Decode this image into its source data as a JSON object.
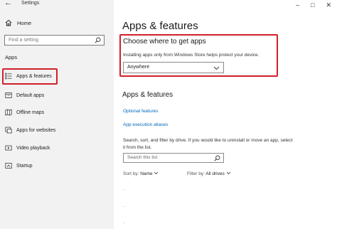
{
  "window": {
    "title": "Settings",
    "back_glyph": "←",
    "close_glyph": "✕",
    "minimize_glyph": "–",
    "maximize_glyph": "□"
  },
  "sidebar": {
    "home_label": "Home",
    "search_placeholder": "Find a setting",
    "section_label": "Apps",
    "items": [
      {
        "label": "Apps & features",
        "icon": "list-icon"
      },
      {
        "label": "Default apps",
        "icon": "default-apps-icon"
      },
      {
        "label": "Offline maps",
        "icon": "map-icon"
      },
      {
        "label": "Apps for websites",
        "icon": "apps-for-websites-icon"
      },
      {
        "label": "Video playback",
        "icon": "video-icon"
      },
      {
        "label": "Startup",
        "icon": "startup-icon"
      }
    ]
  },
  "main": {
    "title": "Apps & features",
    "choose_section": {
      "heading": "Choose where to get apps",
      "description": "Installing apps only from Windows Store helps protect your device.",
      "dropdown_value": "Anywhere"
    },
    "features_section": {
      "heading": "Apps & features",
      "link_optional": "Optional features",
      "link_aliases": "App execution aliases",
      "paragraph": "Search, sort, and filter by drive. If you would like to uninstall or move an app, select it from the list.",
      "search_placeholder": "Search this list",
      "sort_label": "Sort by:",
      "sort_value": "Name",
      "filter_label": "Filter by:",
      "filter_value": "All drives"
    }
  },
  "colors": {
    "sidebar_bg": "#f2f2f2",
    "accent_link": "#0067b8",
    "highlight_border": "#d0202a"
  }
}
